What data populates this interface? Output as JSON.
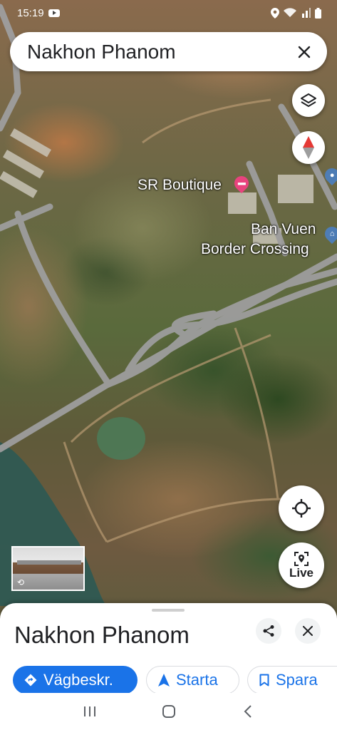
{
  "status_bar": {
    "time": "15:19"
  },
  "search": {
    "query": "Nakhon Phanom"
  },
  "map_labels": {
    "poi_sr_boutique": "SR Boutique",
    "poi_border_line1": "Ban Vuen",
    "poi_border_line2": "Border Crossing"
  },
  "map_buttons": {
    "live_label": "Live"
  },
  "bottom_sheet": {
    "title": "Nakhon Phanom",
    "actions": {
      "directions": "Vägbeskr.",
      "start": "Starta",
      "save": "Spara"
    }
  },
  "colors": {
    "accent": "#1a73e8",
    "hotel_pin": "#e8437e",
    "landmark_pin": "#4e7db5",
    "compass_red": "#e53935",
    "road": "#9e9e9e"
  },
  "icons": [
    "youtube-icon",
    "location-status-icon",
    "wifi-icon",
    "signal-icon",
    "battery-icon",
    "close-icon",
    "layers-icon",
    "compass-icon",
    "hotel-pin-icon",
    "landmark-pin-icon",
    "my-location-icon",
    "live-view-icon",
    "share-icon",
    "directions-icon",
    "navigation-arrow-icon",
    "bookmark-icon",
    "recent-apps-icon",
    "home-icon",
    "back-icon"
  ]
}
